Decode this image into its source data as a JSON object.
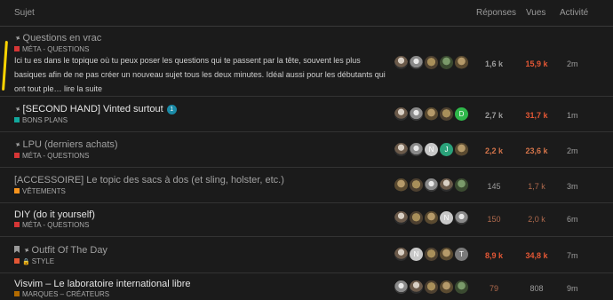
{
  "header": {
    "subject": "Sujet",
    "replies": "Réponses",
    "views": "Vues",
    "activity": "Activité"
  },
  "topics": [
    {
      "title": "Questions en vrac",
      "category": "MÉTA - QUESTIONS",
      "category_color": "#d63636",
      "excerpt": "Ici tu es dans le topique où tu peux poser les questions qui te passent par la tête, souvent les plus basiques afin de ne pas créer un nouveau sujet tous les deux minutes. Idéal aussi pour les débutants qui ont tout ple… lire la suite",
      "replies": "1,6 k",
      "views": "15,9 k",
      "activity": "2m"
    },
    {
      "title": "[SECOND HAND] Vinted surtout",
      "badge": "1",
      "category": "BONS PLANS",
      "category_color": "#12a89d",
      "avatar_letters": [
        "D"
      ],
      "replies": "2,7 k",
      "views": "31,7 k",
      "activity": "1m"
    },
    {
      "title": "LPU (derniers achats)",
      "category": "MÉTA - QUESTIONS",
      "category_color": "#d63636",
      "avatar_letters": [
        "N",
        "J"
      ],
      "replies": "2,2 k",
      "views": "23,6 k",
      "activity": "2m"
    },
    {
      "title": "[ACCESSOIRE] Le topic des sacs à dos (et sling, holster, etc.)",
      "category": "VÊTEMENTS",
      "category_color": "#f7941d",
      "replies": "145",
      "views": "1,7 k",
      "activity": "3m"
    },
    {
      "title": "DIY (do it yourself)",
      "category": "MÉTA - QUESTIONS",
      "category_color": "#d63636",
      "avatar_letters": [
        "N"
      ],
      "replies": "150",
      "views": "2,0 k",
      "activity": "6m"
    },
    {
      "title": "Outfit Of The Day",
      "category": "STYLE",
      "category_color": "#e45735",
      "avatar_letters": [
        "N",
        "T"
      ],
      "replies": "8,9 k",
      "views": "34,8 k",
      "activity": "7m"
    },
    {
      "title": "Visvim – Le laboratoire international libre",
      "category": "MARQUES – CRÉATEURS",
      "category_color": "#b36b00",
      "replies": "79",
      "views": "808",
      "activity": "9m"
    }
  ]
}
